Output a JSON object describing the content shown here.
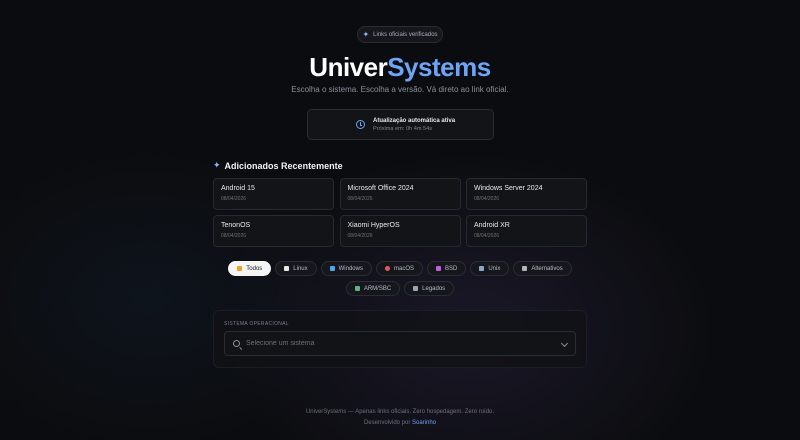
{
  "badge": {
    "icon": "sparkle-icon",
    "text": "Links oficiais verificados"
  },
  "brand": {
    "part1": "Univer",
    "part2": "Systems",
    "color_accent": "#6ea3f5"
  },
  "subtitle": "Escolha o sistema. Escolha a versão. Vá direto ao link oficial.",
  "update": {
    "icon": "clock-icon",
    "title": "Atualização automática ativa",
    "next": "Próxima em: 0h 4m 54s"
  },
  "recent": {
    "icon": "sparkle-icon",
    "heading": "Adicionados Recentemente",
    "items": [
      {
        "name": "Android 15",
        "date": "08/04/2026"
      },
      {
        "name": "Microsoft Office 2024",
        "date": "08/04/2026"
      },
      {
        "name": "Windows Server 2024",
        "date": "08/04/2026"
      },
      {
        "name": "TenonOS",
        "date": "08/04/2026"
      },
      {
        "name": "Xiaomi HyperOS",
        "date": "08/04/2026"
      },
      {
        "name": "Android XR",
        "date": "08/04/2026"
      }
    ]
  },
  "filters": [
    {
      "label": "Todos",
      "icon": "lightning-icon",
      "color": "#f0a020",
      "active": true
    },
    {
      "label": "Linux",
      "icon": "penguin-icon",
      "color": "#e8e8e8",
      "active": false
    },
    {
      "label": "Windows",
      "icon": "windows-icon",
      "color": "#4aa8e8",
      "active": false
    },
    {
      "label": "macOS",
      "icon": "apple-icon",
      "color": "#e05a5a",
      "active": false
    },
    {
      "label": "BSD",
      "icon": "bsd-icon",
      "color": "#c060e0",
      "active": false
    },
    {
      "label": "Unix",
      "icon": "terminal-icon",
      "color": "#8aa6c8",
      "active": false
    },
    {
      "label": "Alternativos",
      "icon": "device-icon",
      "color": "#b0b4bc",
      "active": false
    },
    {
      "label": "ARM/SBC",
      "icon": "board-icon",
      "color": "#60b080",
      "active": false
    },
    {
      "label": "Legados",
      "icon": "floppy-icon",
      "color": "#a0a4ac",
      "active": false
    }
  ],
  "selector": {
    "label": "SISTEMA OPERACIONAL",
    "placeholder": "Selecione um sistema"
  },
  "footer": {
    "line1": "UniverSystems — Apenas links oficiais. Zero hospedagem. Zero ruído.",
    "line2_prefix": "Desenvolvido por ",
    "author": "Soarinho"
  }
}
